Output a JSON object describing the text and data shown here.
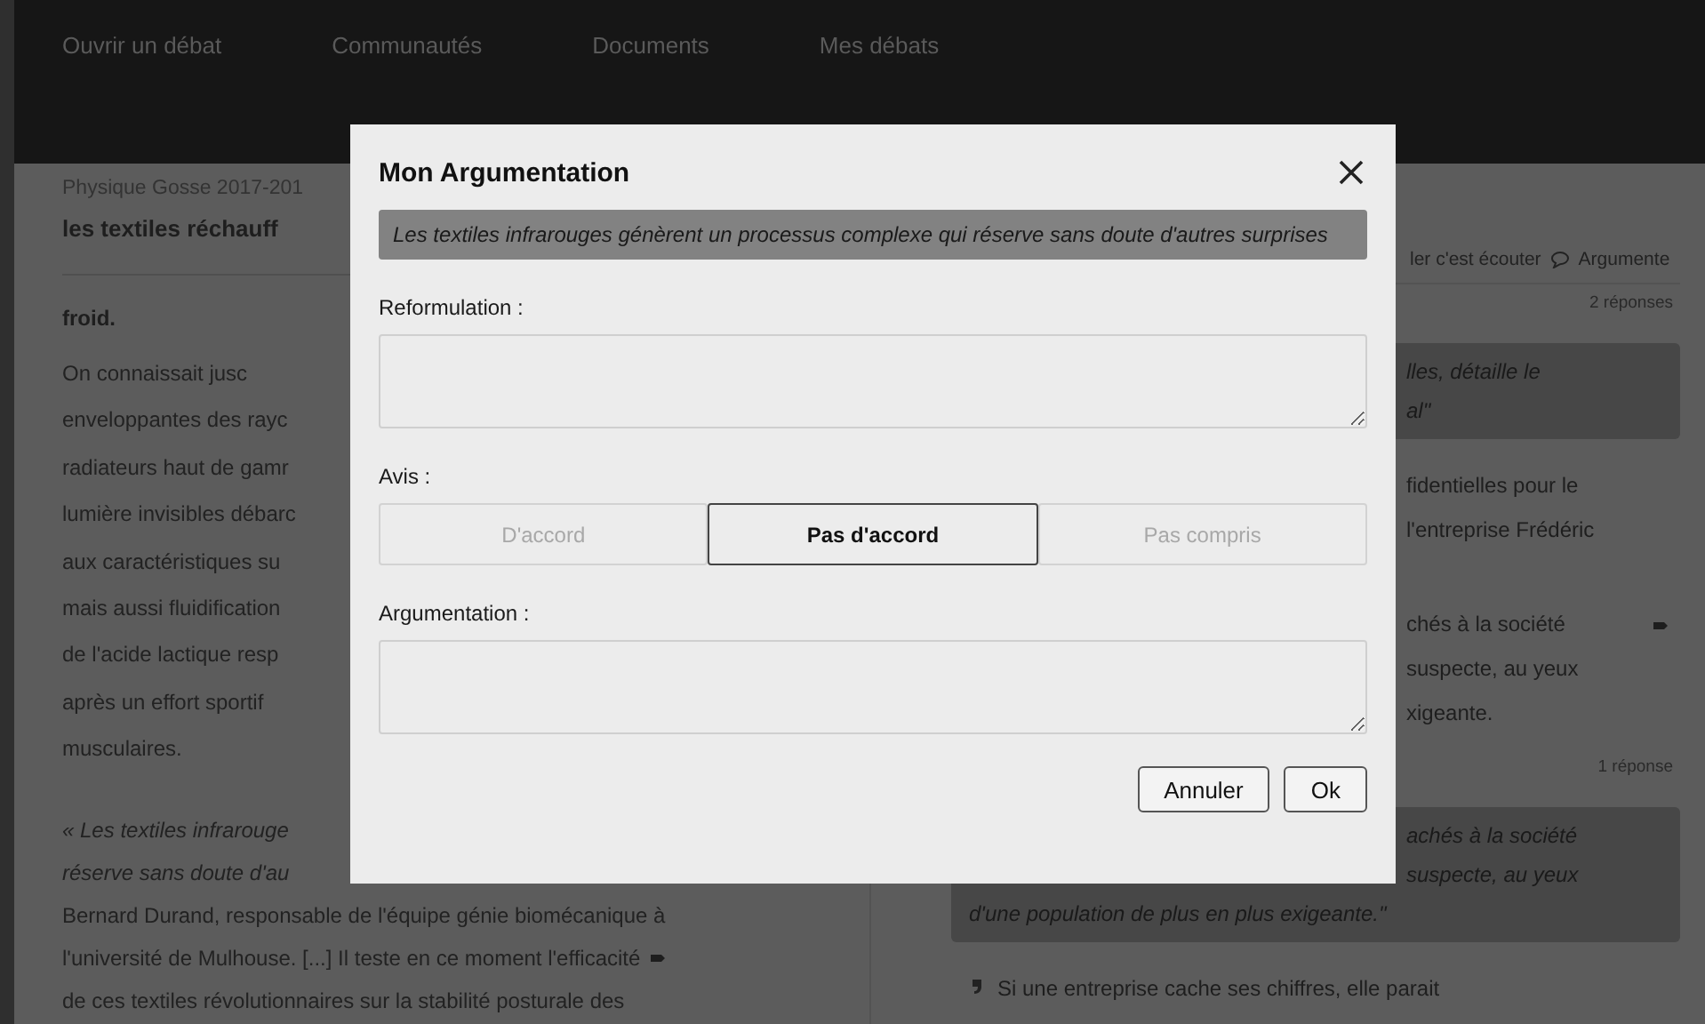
{
  "nav": {
    "items": [
      "Ouvrir un débat",
      "Communautés",
      "Documents",
      "Mes débats"
    ]
  },
  "article": {
    "course": "Physique Gosse 2017-201",
    "title": "les textiles réchauff",
    "lead": "froid.",
    "paragraph": [
      "On   connaissait   jusc",
      "enveloppantes des rayc",
      "radiateurs haut de gamr",
      "lumière invisibles débarc",
      "aux caractéristiques su",
      "mais aussi fluidification",
      "de l'acide lactique resp",
      "après un effort sportif",
      "musculaires."
    ],
    "quote": [
      "« Les textiles infrarouge",
      "réserve sans doute d'au"
    ],
    "body": [
      {
        "text": "Bernard Durand, responsable de l'équipe génie biomécanique à",
        "marker": false
      },
      {
        "text": "l'université de Mulhouse. [...] Il teste en ce moment l'efficacité",
        "marker": true
      },
      {
        "text": "de ces textiles révolutionnaires sur la stabilité posturale des",
        "marker": false
      }
    ]
  },
  "discussion": {
    "toolbar": [
      "ler c'est écouter",
      "Argumente"
    ],
    "threads": [
      {
        "count": "2 réponses",
        "quote": [
          {
            "text": "lles, détaille le",
            "kind": "tail"
          },
          {
            "text": "al\"",
            "kind": "tail"
          }
        ],
        "comments": [
          {
            "lines": [
              "fidentielles pour le",
              "l'entreprise Frédéric"
            ],
            "kind": "tail",
            "marker": false
          },
          {
            "lines": [
              "chés à la société",
              "suspecte, au yeux",
              "xigeante."
            ],
            "kind": "tail",
            "marker": true
          }
        ]
      },
      {
        "count": "1 réponse",
        "quote": [
          {
            "text": "achés à la société",
            "kind": "tail"
          },
          {
            "text": "suspecte, au yeux",
            "kind": "tail"
          },
          {
            "text": "d'une population de plus en plus exigeante.\"",
            "kind": "full"
          }
        ],
        "comments": [
          {
            "lines": [
              "Si une entreprise cache ses chiffres, elle parait"
            ],
            "kind": "quoted",
            "marker": false
          }
        ]
      }
    ]
  },
  "dialog": {
    "title": "Mon Argumentation",
    "statement": "Les textiles infrarouges génèrent un processus complexe qui réserve sans doute d'autres surprises",
    "reformulation_label": "Reformulation :",
    "opinion_label": "Avis :",
    "opinions": [
      {
        "label": "D'accord",
        "selected": false
      },
      {
        "label": "Pas d'accord",
        "selected": true
      },
      {
        "label": "Pas compris",
        "selected": false
      }
    ],
    "argument_label": "Argumentation :",
    "buttons": [
      "Annuler",
      "Ok"
    ]
  }
}
